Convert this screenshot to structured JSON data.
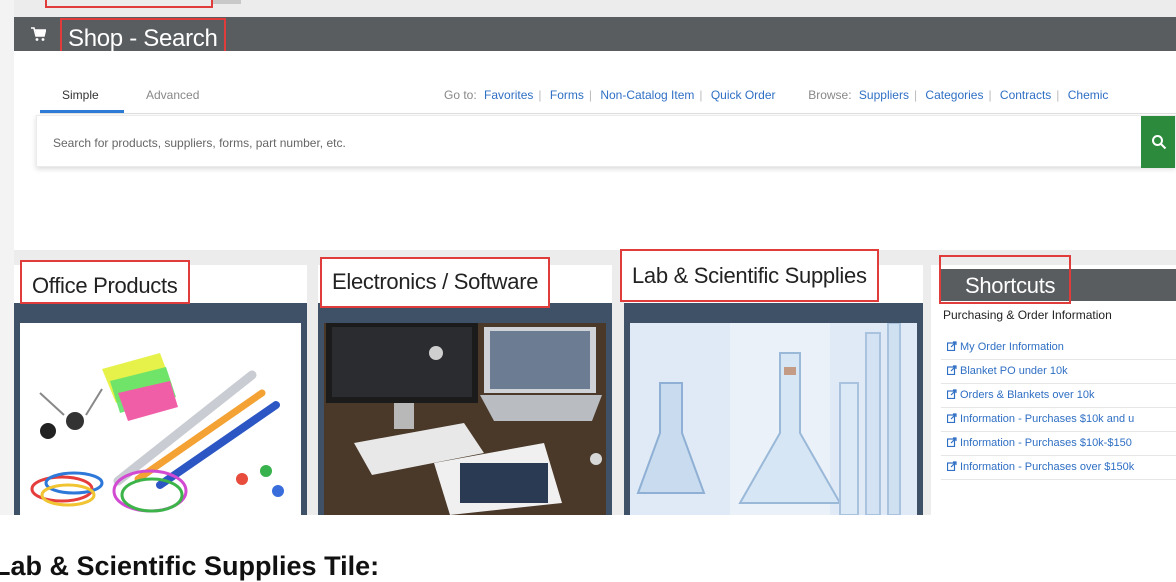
{
  "header": {
    "title": "Shop - Search"
  },
  "tabs": [
    {
      "label": "Simple"
    },
    {
      "label": "Advanced"
    }
  ],
  "goto": {
    "label": "Go to:",
    "links": [
      "Favorites",
      "Forms",
      "Non-Catalog Item",
      "Quick Order"
    ]
  },
  "browse": {
    "label": "Browse:",
    "links": [
      "Suppliers",
      "Categories",
      "Contracts",
      "Chemic"
    ]
  },
  "search": {
    "placeholder": "Search for products, suppliers, forms, part number, etc."
  },
  "tiles": [
    {
      "title": "Office Products"
    },
    {
      "title": "Electronics / Software"
    },
    {
      "title": "Lab & Scientific Supplies"
    }
  ],
  "shortcuts": {
    "title": "Shortcuts",
    "subtitle": "Purchasing & Order Information",
    "links": [
      "My Order Information",
      "Blanket PO under 10k",
      "Orders & Blankets over 10k",
      "Information - Purchases $10k and u",
      "Information - Purchases $10k-$150",
      "Information - Purchases over $150k"
    ]
  },
  "caption": "Lab & Scientific Supplies Tile:",
  "colors": {
    "header_bar": "#595d60",
    "link": "#2f6fc4",
    "search_button": "#2c8a3c",
    "tile_frame": "#3f5167",
    "highlight_box": "#e03c3c"
  },
  "icons": [
    "cart-icon",
    "search-icon",
    "external-link-icon"
  ]
}
